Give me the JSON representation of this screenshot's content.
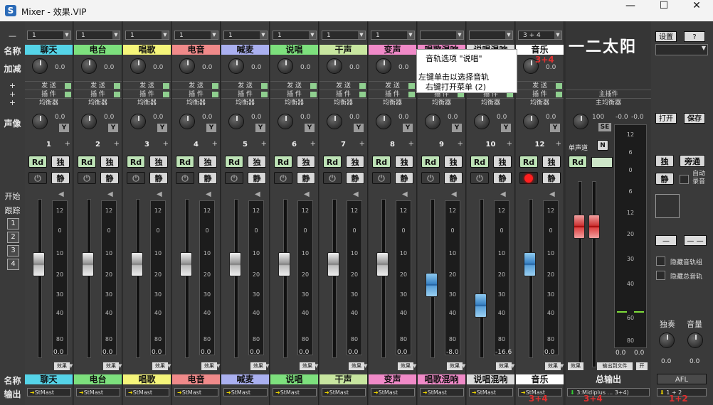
{
  "window": {
    "title": "Mixer - 效果.VIP",
    "icon": "S",
    "minimize": "—",
    "maximize": "☐",
    "close": "✕"
  },
  "left_labels": {
    "dash": "—",
    "name": "名称",
    "gain": "加减",
    "pan": "声像",
    "start": "开始",
    "track": "跟踪",
    "num1": "1",
    "num2": "2",
    "num3": "3",
    "num4": "4",
    "name_bottom": "名称",
    "output": "输出",
    "plus": "+"
  },
  "channels": [
    {
      "number": "1",
      "input": "1",
      "name": "聊天",
      "color": "#55d4e8",
      "gain": "0.0",
      "pan": "0.0",
      "meter_value": "0.0",
      "output": "StMast",
      "fader": 0.42,
      "fader_color": "gray",
      "rec": false
    },
    {
      "number": "2",
      "input": "1",
      "name": "电台",
      "color": "#7de07d",
      "gain": "0.0",
      "pan": "0.0",
      "meter_value": "0.0",
      "output": "StMast",
      "fader": 0.42,
      "fader_color": "gray",
      "rec": false
    },
    {
      "number": "3",
      "input": "1",
      "name": "唱歌",
      "color": "#f5f57a",
      "gain": "0.0",
      "pan": "0.0",
      "meter_value": "0.0",
      "output": "StMast",
      "fader": 0.42,
      "fader_color": "gray",
      "rec": false
    },
    {
      "number": "4",
      "input": "1",
      "name": "电音",
      "color": "#f08a8a",
      "gain": "0.0",
      "pan": "0.0",
      "meter_value": "0.0",
      "output": "StMast",
      "fader": 0.42,
      "fader_color": "gray",
      "rec": false
    },
    {
      "number": "5",
      "input": "1",
      "name": "喊麦",
      "color": "#aab0f0",
      "gain": "0.0",
      "pan": "0.0",
      "meter_value": "0.0",
      "output": "StMast",
      "fader": 0.42,
      "fader_color": "gray",
      "rec": false
    },
    {
      "number": "6",
      "input": "1",
      "name": "说唱",
      "color": "#7de07d",
      "gain": "0.0",
      "pan": "0.0",
      "meter_value": "0.0",
      "output": "StMast",
      "fader": 0.42,
      "fader_color": "gray",
      "rec": false
    },
    {
      "number": "7",
      "input": "1",
      "name": "干声",
      "color": "#c8e6a0",
      "gain": "0.0",
      "pan": "0.0",
      "meter_value": "0.0",
      "output": "StMast",
      "fader": 0.42,
      "fader_color": "gray",
      "rec": false
    },
    {
      "number": "8",
      "input": "1",
      "name": "变声",
      "color": "#f08ac8",
      "gain": "0.0",
      "pan": "0.0",
      "meter_value": "0.0",
      "output": "StMast",
      "fader": 0.42,
      "fader_color": "gray",
      "rec": false
    },
    {
      "number": "9",
      "input": "",
      "name": "唱歌混响",
      "color": "#f08ac8",
      "gain": "0.0",
      "pan": "0.0",
      "meter_value": "-8.0",
      "output": "StMast",
      "fader": 0.55,
      "fader_color": "blue",
      "rec": false
    },
    {
      "number": "10",
      "input": "",
      "name": "说唱混响",
      "color": "#dcdcdc",
      "gain": "0.0",
      "pan": "0.0",
      "meter_value": "-16.6",
      "output": "StMast",
      "fader": 0.68,
      "fader_color": "blue",
      "rec": false
    },
    {
      "number": "12",
      "input": "3 + 4",
      "name": "音乐",
      "color": "#ffffff",
      "gain": "0.0",
      "pan": "0.0",
      "meter_value": "0.0",
      "output": "StMast",
      "fader": 0.42,
      "fader_color": "blue",
      "rec": true
    }
  ],
  "strip_labels": {
    "send": "发 送",
    "insert": "插 件",
    "eq": "均衡器",
    "rd": "Rd",
    "solo": "独",
    "mute": "静",
    "y": "Y",
    "fx": "效果",
    "power": "⏻",
    "speaker": "◀"
  },
  "meter_scale": [
    "12",
    "0",
    "10",
    "20",
    "30",
    "40",
    "80",
    "0.0"
  ],
  "tooltip": {
    "line1": "音轨选项 \"说唱\"",
    "line2": "左键单击以选择音轨",
    "line3": "右键打开菜单 (2)"
  },
  "master": {
    "logo_text": "一二太阳",
    "main_insert": "主插件",
    "main_eq": "主均衡器",
    "pan_value": "100",
    "se": "SE",
    "mono": "单声道",
    "n": "N",
    "rd": "Rd",
    "meter_l": "-0.0",
    "meter_r": "-0.0",
    "scale": [
      "12",
      "6",
      "0",
      "6",
      "12",
      "20",
      "30",
      "40",
      "60",
      "80"
    ],
    "meter_val_l": "0.0",
    "meter_val_r": "0.0",
    "fx": "效果",
    "output_to_file": "输出到文件",
    "open": "开",
    "name": "总输出",
    "output": "3:Midiplus ... 3+4)",
    "fader": 0.32
  },
  "right_panel": {
    "settings": "设置",
    "help": "?",
    "open": "打开",
    "save": "保存",
    "solo": "独",
    "bypass": "旁通",
    "mute": "静",
    "auto_record": "自动录音",
    "dash1": "—",
    "dash2": "— —",
    "hide_track_group": "隐藏音轨组",
    "hide_master_track": "隐藏总音轨",
    "solo_label": "独奏",
    "volume_label": "音量",
    "solo_val": "0.0",
    "volume_val": "0.0",
    "afl": "AFL",
    "output": "1 + 2"
  },
  "annotations": {
    "a1": "3+4",
    "a2": "3+4",
    "a3": "3+4",
    "a4": "1+2"
  }
}
